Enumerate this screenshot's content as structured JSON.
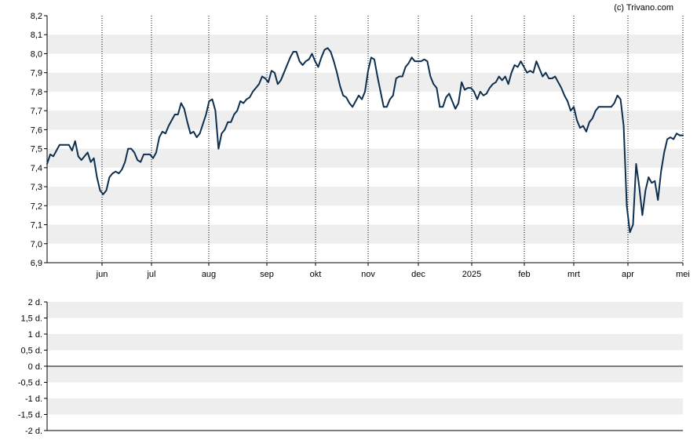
{
  "watermark": "(c) Trivano.com",
  "colors": {
    "line": "#0d2f4f",
    "band": "#eeeeee"
  },
  "chart_data": [
    {
      "type": "line",
      "title": "",
      "xlabel": "",
      "ylabel": "",
      "ylim": [
        6.9,
        8.2
      ],
      "y_ticks": [
        "6,9",
        "7,0",
        "7,1",
        "7,2",
        "7,3",
        "7,4",
        "7,5",
        "7,6",
        "7,7",
        "7,8",
        "7,9",
        "8,0",
        "8,1",
        "8,2"
      ],
      "x_ticks": [
        "jun",
        "jul",
        "aug",
        "sep",
        "okt",
        "nov",
        "dec",
        "2025",
        "feb",
        "mrt",
        "apr",
        "mei"
      ],
      "grid": "alternating horizontal bands, dotted vertical lines at month boundaries",
      "x": [
        0,
        1,
        2,
        3,
        4,
        5,
        6,
        7,
        8,
        9,
        10,
        11,
        12,
        13,
        14,
        15,
        16,
        17,
        18,
        19,
        20,
        21,
        22,
        23,
        24,
        25,
        26,
        27,
        28,
        29,
        30,
        31,
        32,
        33,
        34,
        35,
        36,
        37,
        38,
        39,
        40,
        41,
        42,
        43,
        44,
        45,
        46,
        47,
        48,
        49,
        50,
        51,
        52,
        53,
        54,
        55,
        56,
        57,
        58,
        59,
        60,
        61,
        62,
        63,
        64,
        65,
        66,
        67,
        68,
        69,
        70,
        71,
        72,
        73,
        74,
        75,
        76,
        77,
        78,
        79,
        80,
        81,
        82,
        83,
        84,
        85,
        86,
        87,
        88,
        89,
        90,
        91,
        92,
        93,
        94,
        95,
        96,
        97,
        98,
        99,
        100,
        101,
        102,
        103,
        104,
        105,
        106,
        107,
        108,
        109,
        110,
        111,
        112,
        113,
        114,
        115,
        116,
        117,
        118,
        119,
        120,
        121,
        122,
        123,
        124,
        125,
        126,
        127,
        128,
        129,
        130,
        131,
        132,
        133,
        134,
        135,
        136,
        137,
        138,
        139,
        140,
        141,
        142,
        143,
        144,
        145,
        146,
        147,
        148,
        149,
        150,
        151,
        152,
        153,
        154,
        155,
        156,
        157,
        158,
        159,
        160,
        161,
        162,
        163,
        164,
        165,
        166,
        167,
        168,
        169,
        170,
        171,
        172,
        173,
        174,
        175,
        176,
        177,
        178,
        179,
        180,
        181,
        182,
        183,
        184,
        185,
        186,
        187,
        188,
        189,
        190,
        191,
        192,
        193,
        194,
        195,
        196,
        197,
        198,
        199,
        200,
        201,
        202,
        203,
        204,
        205,
        206,
        207,
        208,
        209,
        210,
        211,
        212,
        213,
        214,
        215,
        216,
        217,
        218,
        219,
        220,
        221,
        222,
        223,
        224,
        225,
        226,
        227,
        228,
        229,
        230,
        231,
        232,
        233,
        234,
        235,
        236,
        237,
        238,
        239,
        240,
        241,
        242,
        243,
        244,
        245,
        246,
        247,
        248,
        249,
        250,
        251,
        252,
        253,
        254,
        255,
        256
      ],
      "series": [
        {
          "values": [
            7.42,
            7.47,
            7.46,
            7.49,
            7.52,
            7.52,
            7.52,
            7.52,
            7.49,
            7.54,
            7.46,
            7.44,
            7.46,
            7.48,
            7.43,
            7.45,
            7.35,
            7.28,
            7.26,
            7.28,
            7.35,
            7.37,
            7.38,
            7.37,
            7.39,
            7.43,
            7.5,
            7.5,
            7.48,
            7.44,
            7.43,
            7.47,
            7.47,
            7.47,
            7.45,
            7.48,
            7.56,
            7.59,
            7.58,
            7.62,
            7.65,
            7.68,
            7.68,
            7.74,
            7.71,
            7.64,
            7.58,
            7.59,
            7.56,
            7.58,
            7.63,
            7.68,
            7.75,
            7.76,
            7.7,
            7.5,
            7.58,
            7.6,
            7.64,
            7.64,
            7.68,
            7.7,
            7.75,
            7.74,
            7.76,
            7.77,
            7.8,
            7.82,
            7.84,
            7.88,
            7.87,
            7.85,
            7.91,
            7.9,
            7.84,
            7.86,
            7.9,
            7.94,
            7.98,
            8.01,
            8.01,
            7.96,
            7.94,
            7.96,
            7.97,
            8.0,
            7.96,
            7.93,
            7.98,
            8.02,
            8.03,
            8.01,
            7.96,
            7.9,
            7.83,
            7.78,
            7.77,
            7.74,
            7.72,
            7.75,
            7.78,
            7.76,
            7.8,
            7.91,
            7.98,
            7.97,
            7.88,
            7.8,
            7.72,
            7.72,
            7.76,
            7.78,
            7.87,
            7.88,
            7.88,
            7.93,
            7.95,
            7.98,
            7.96,
            7.96,
            7.96,
            7.97,
            7.96,
            7.88,
            7.84,
            7.82,
            7.72,
            7.72,
            7.77,
            7.79,
            7.75,
            7.71,
            7.74,
            7.85,
            7.81,
            7.82,
            7.82,
            7.8,
            7.76,
            7.8,
            7.78,
            7.79,
            7.82,
            7.84,
            7.85,
            7.88,
            7.86,
            7.88,
            7.84,
            7.9,
            7.94,
            7.93,
            7.96,
            7.93,
            7.9,
            7.91,
            7.9,
            7.96,
            7.92,
            7.88,
            7.9,
            7.87,
            7.87,
            7.88,
            7.85,
            7.82,
            7.78,
            7.75,
            7.7,
            7.72,
            7.65,
            7.61,
            7.62,
            7.59,
            7.64,
            7.66,
            7.7,
            7.72,
            7.72,
            7.72,
            7.72,
            7.72,
            7.74,
            7.78,
            7.76,
            7.62,
            7.2,
            7.06,
            7.1,
            7.42,
            7.3,
            7.15,
            7.28,
            7.35,
            7.32,
            7.33,
            7.23,
            7.38,
            7.48,
            7.55,
            7.56,
            7.55,
            7.58,
            7.57,
            7.57
          ]
        }
      ]
    },
    {
      "type": "line",
      "title": "",
      "ylim": [
        -2,
        2
      ],
      "y_ticks": [
        "2 d.",
        "1,5 d.",
        "1 d.",
        "0,5 d.",
        "0 d.",
        "-0,5 d.",
        "-1 d.",
        "-1,5 d.",
        "-2 d."
      ],
      "grid": "alternating horizontal bands",
      "series": []
    }
  ]
}
